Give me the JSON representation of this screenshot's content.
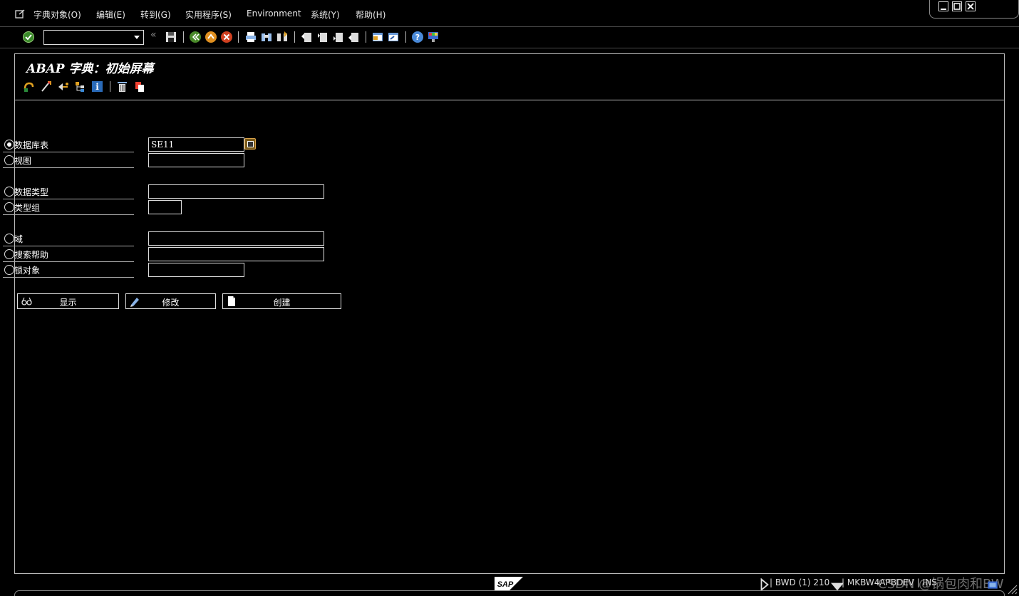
{
  "menubar": {
    "items": [
      "字典对象(O)",
      "编辑(E)",
      "转到(G)",
      "实用程序(S)",
      "Environment",
      "系统(Y)",
      "帮助(H)"
    ]
  },
  "toolbar": {
    "command_field_value": "",
    "icons": [
      "enter-icon",
      "save-icon",
      "back-icon",
      "exit-icon",
      "cancel-icon",
      "print-icon",
      "find-icon",
      "find-next-icon",
      "first-page-icon",
      "previous-page-icon",
      "next-page-icon",
      "last-page-icon",
      "create-session-icon",
      "shortcut-icon",
      "help-icon",
      "customize-layout-icon"
    ]
  },
  "page": {
    "title": "ABAP 字典：初始屏幕"
  },
  "form": {
    "rows": [
      {
        "label": "数据库表",
        "value": "SE11",
        "selected": true
      },
      {
        "label": "视图",
        "value": "",
        "selected": false
      },
      {
        "label": "数据类型",
        "value": "",
        "selected": false
      },
      {
        "label": "类型组",
        "value": "",
        "selected": false
      },
      {
        "label": "域",
        "value": "",
        "selected": false
      },
      {
        "label": "搜索帮助",
        "value": "",
        "selected": false
      },
      {
        "label": "锁对象",
        "value": "",
        "selected": false
      }
    ]
  },
  "buttons": {
    "display": "显示",
    "change": "修改",
    "create": "创建"
  },
  "statusbar": {
    "system": "| BWD (1) 210",
    "server": "| MKBW4APBDEV | INS",
    "logo": "SAP"
  },
  "watermark": "CSDN @锅包肉和BW"
}
